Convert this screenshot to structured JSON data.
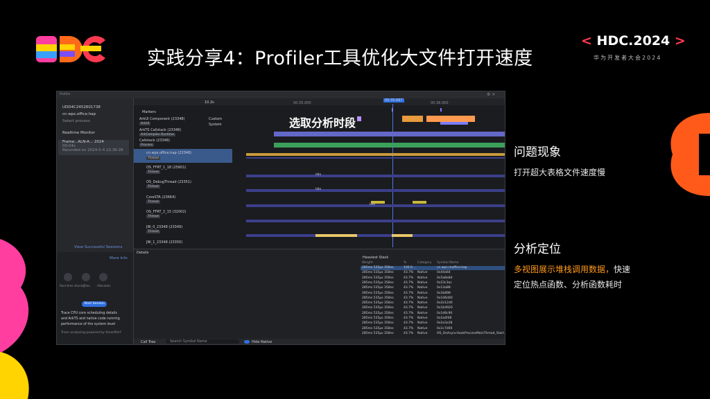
{
  "header": {
    "title": "实践分享4：Profiler工具优化大文件打开速度",
    "brand_left": "<",
    "brand_text": "HDC.2024",
    "brand_right": ">",
    "brand_sub": "华为开发者大会2024"
  },
  "window": {
    "titlebar_text": "Profiler",
    "sidebar": {
      "device": "UDD4C2452601738",
      "app": "cn.wps.office.hap",
      "hint": "Select process",
      "realtime": "Realtime Monitor",
      "frame": "Frame...ALN-A... 2024",
      "frame_time": "00:04s",
      "recorded": "Recorded on 2024-5-4 22:36:28",
      "view_sessions": "View Successful Sessions",
      "more": "More Info",
      "icons": [
        "Rare-time sharing",
        "Time",
        "Allocation"
      ],
      "start_button": "Start Session",
      "desc1": "Trace CPU core scheduling details",
      "desc2": "and ArkTS and native code running",
      "desc3": "performance of the system level",
      "desc4": "Trace analysing powered by SmartPerf"
    },
    "timeline": {
      "time_label": "10.2s",
      "marker_time": "00:35.697",
      "tick_a": "00:35.000",
      "tick_b": "00:36.000",
      "rows": [
        {
          "name": "Markers",
          "tag": ""
        },
        {
          "name": "ArkUI Component (23348)",
          "tag": "ArkUI"
        },
        {
          "name": "ArkTS Callstack (23348)",
          "tag": "ArkCompiler Runtime"
        },
        {
          "name": "Callstack (23348)",
          "tag": "Process"
        },
        {
          "name": "cn.wps.office.hap (23348)",
          "tag": "Thread"
        },
        {
          "name": "OS_FFRT_1_18 (25601)",
          "tag": "Thread"
        },
        {
          "name": "OS_DebugThread (23351)",
          "tag": "Thread"
        },
        {
          "name": "CoreSTA (23664)",
          "tag": "Thread"
        },
        {
          "name": "OS_FFRT_2_15 (32002)",
          "tag": "Thread"
        },
        {
          "name": "JNI_0_23348 (23349)",
          "tag": "Thread"
        },
        {
          "name": "JNI_1_23348 (23350)",
          "tag": ""
        }
      ],
      "custom": "Custom",
      "system": "System",
      "idle": "Idle"
    },
    "overlay_text": "选取分析时段",
    "details": {
      "tab": "Details",
      "section": "Heaviest Stack",
      "headers": [
        "Weight",
        "%",
        "Category",
        "Symbol Name"
      ],
      "rows": [
        [
          "285ms 535μs 358ns",
          "100.0...",
          "",
          "cn.wps.moffice.hap"
        ],
        [
          "285ms 535μs 358ns",
          "43.7%",
          "Native",
          "0x44a64"
        ],
        [
          "285ms 535μs 358ns",
          "43.7%",
          "Native",
          "0x5a8e8d"
        ],
        [
          "285ms 535μs 358ns",
          "43.7%",
          "Native",
          "0x23c3ac"
        ],
        [
          "285ms 535μs 358ns",
          "43.7%",
          "Native",
          "0x13a88"
        ],
        [
          "285ms 535μs 358ns",
          "43.7%",
          "Native",
          "0x1b898"
        ],
        [
          "285ms 535μs 358ns",
          "43.7%",
          "Native",
          "0x1d6d40"
        ],
        [
          "285ms 535μs 358ns",
          "43.7%",
          "Native",
          "0x2e12d0"
        ],
        [
          "285ms 535μs 358ns",
          "43.7%",
          "Native",
          "0x1b4920"
        ],
        [
          "285ms 535μs 358ns",
          "43.7%",
          "Native",
          "0x1d6c90"
        ],
        [
          "285ms 535μs 358ns",
          "43.7%",
          "Native",
          "0x2a4f48"
        ],
        [
          "285ms 535μs 358ns",
          "43.7%",
          "Native",
          "0x2a3a38"
        ],
        [
          "285ms 535μs 358ns",
          "43.7%",
          "Native",
          "0x1c7d00"
        ],
        [
          "285ms 535μs 358ns",
          "43.7%",
          "Native",
          "OS_OnAsyncHookProcessMainThread_Start..."
        ]
      ],
      "call_tree": "Call Tree",
      "search_placeholder": "Search Symbol Name",
      "toggle_label": "Hide Native"
    }
  },
  "right": {
    "section1_title": "问题现象",
    "section1_text": "打开超大表格文件速度慢",
    "section2_title": "分析定位",
    "section2_hl": "多视图展示堆栈调用数据，",
    "section2_text_a": "快速",
    "section2_text_b": "定位热点函数、分析函数耗时"
  },
  "colors": {
    "accent_orange": "#ff5a1a",
    "accent_pink": "#ff3ea0",
    "accent_yellow": "#ffd400",
    "highlight": "#ff9a1a",
    "track_blue": "#3c3f8a"
  }
}
